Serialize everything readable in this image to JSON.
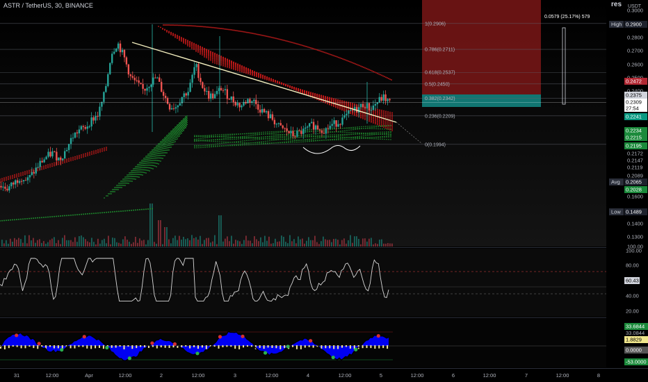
{
  "header": {
    "symbol": "ASTR / TetherUS, 30, BINANCE",
    "corner_text": "res",
    "currency": "USDT"
  },
  "measure": {
    "text": "0.0579 (25.17%) 579"
  },
  "fib_levels": [
    {
      "label": "1(0.2906)",
      "value": 0.2906
    },
    {
      "label": "0.786(0.2711)",
      "value": 0.2711
    },
    {
      "label": "0.618(0.2537)",
      "value": 0.2537
    },
    {
      "label": "0.5(0.2450)",
      "value": 0.245
    },
    {
      "label": "0.382(0.2342)",
      "value": 0.2342
    },
    {
      "label": "0.236(0.2209)",
      "value": 0.2209
    },
    {
      "label": "0(0.1994)",
      "value": 0.1994
    }
  ],
  "price_axis": {
    "ticks": [
      "0.3000",
      "0.2900",
      "0.2800",
      "0.2700",
      "0.2600",
      "0.2500",
      "0.2400",
      "0.2300",
      "0.2172",
      "0.2147",
      "0.2119",
      "0.2089",
      "0.1600",
      "0.1400",
      "0.1300",
      "100.00"
    ],
    "badges": [
      {
        "tag": "High",
        "value": "0.2900",
        "color": "#1e222d",
        "text_color": "#ffffff"
      },
      {
        "tag": "",
        "value": "0.2472",
        "color": "#b22833",
        "text_color": "#ffffff"
      },
      {
        "tag": "",
        "value": "0.2375",
        "color": "#d1d4dc",
        "text_color": "#000000"
      },
      {
        "tag": "",
        "value": "0.2309",
        "color": "#ffffff",
        "text_color": "#000000"
      },
      {
        "tag": "",
        "value": "27:54",
        "color": "#ffffff",
        "text_color": "#000000"
      },
      {
        "tag": "",
        "value": "0.2241",
        "color": "#089981",
        "text_color": "#ffffff"
      },
      {
        "tag": "",
        "value": "0.2234",
        "color": "#1b8a3b",
        "text_color": "#ffffff"
      },
      {
        "tag": "",
        "value": "0.2215",
        "color": "#1b8a3b",
        "text_color": "#ffffff"
      },
      {
        "tag": "",
        "value": "0.2195",
        "color": "#1b8a3b",
        "text_color": "#ffffff"
      },
      {
        "tag": "Avg",
        "value": "0.2065",
        "color": "#1e222d",
        "text_color": "#ffffff"
      },
      {
        "tag": "",
        "value": "0.2028",
        "color": "#1b8a3b",
        "text_color": "#ffffff"
      },
      {
        "tag": "Low",
        "value": "0.1489",
        "color": "#1e222d",
        "text_color": "#ffffff"
      }
    ]
  },
  "rsi_axis": {
    "ticks": [
      "100.00",
      "80.00",
      "60.43",
      "40.00",
      "20.00"
    ],
    "current": "60.43"
  },
  "osc_axis": {
    "ticks": [
      "33.0844",
      "0.0000",
      "-53.0000"
    ],
    "badges": [
      {
        "value": "33.6844",
        "color": "#1b8a3b"
      },
      {
        "value": "1.8829",
        "color": "#f0e68c"
      },
      {
        "value": "0.0000",
        "color": "#555555"
      },
      {
        "value": "-53.0000",
        "color": "#1b8a3b"
      }
    ]
  },
  "time_axis": {
    "labels": [
      "31",
      "12:00",
      "Apr",
      "12:00",
      "2",
      "12:00",
      "3",
      "12:00",
      "4",
      "12:00",
      "5",
      "12:00",
      "6",
      "12:00",
      "7",
      "12:00",
      "8"
    ]
  },
  "colors": {
    "bull": "#26a69a",
    "bear": "#ef5350",
    "ribbon_red": "#c41a1a",
    "ribbon_green": "#1e8c2e",
    "trendline": "#f5f0c0",
    "osc_fill": "#0000ff",
    "osc_neg": "#f5e79e",
    "zone_red": "#8b1a1a",
    "zone_green": "#138a85"
  },
  "chart_data": {
    "type": "candlestick",
    "title": "ASTR / TetherUS, 30, BINANCE",
    "y_range": [
      0.125,
      0.302
    ],
    "annotations": {
      "high": 0.29,
      "low": 0.1489,
      "avg": 0.2065,
      "last": 0.2309,
      "rsi_last": 60.43
    },
    "close_path": [
      0.168,
      0.166,
      0.17,
      0.175,
      0.172,
      0.178,
      0.185,
      0.19,
      0.193,
      0.188,
      0.195,
      0.205,
      0.21,
      0.212,
      0.218,
      0.222,
      0.238,
      0.268,
      0.276,
      0.265,
      0.25,
      0.245,
      0.24,
      0.246,
      0.25,
      0.238,
      0.228,
      0.228,
      0.236,
      0.24,
      0.26,
      0.244,
      0.236,
      0.236,
      0.242,
      0.236,
      0.232,
      0.228,
      0.233,
      0.232,
      0.226,
      0.222,
      0.218,
      0.212,
      0.21,
      0.206,
      0.208,
      0.21,
      0.214,
      0.212,
      0.21,
      0.214,
      0.216,
      0.219,
      0.224,
      0.226,
      0.23,
      0.226,
      0.231,
      0.235,
      0.231
    ]
  }
}
